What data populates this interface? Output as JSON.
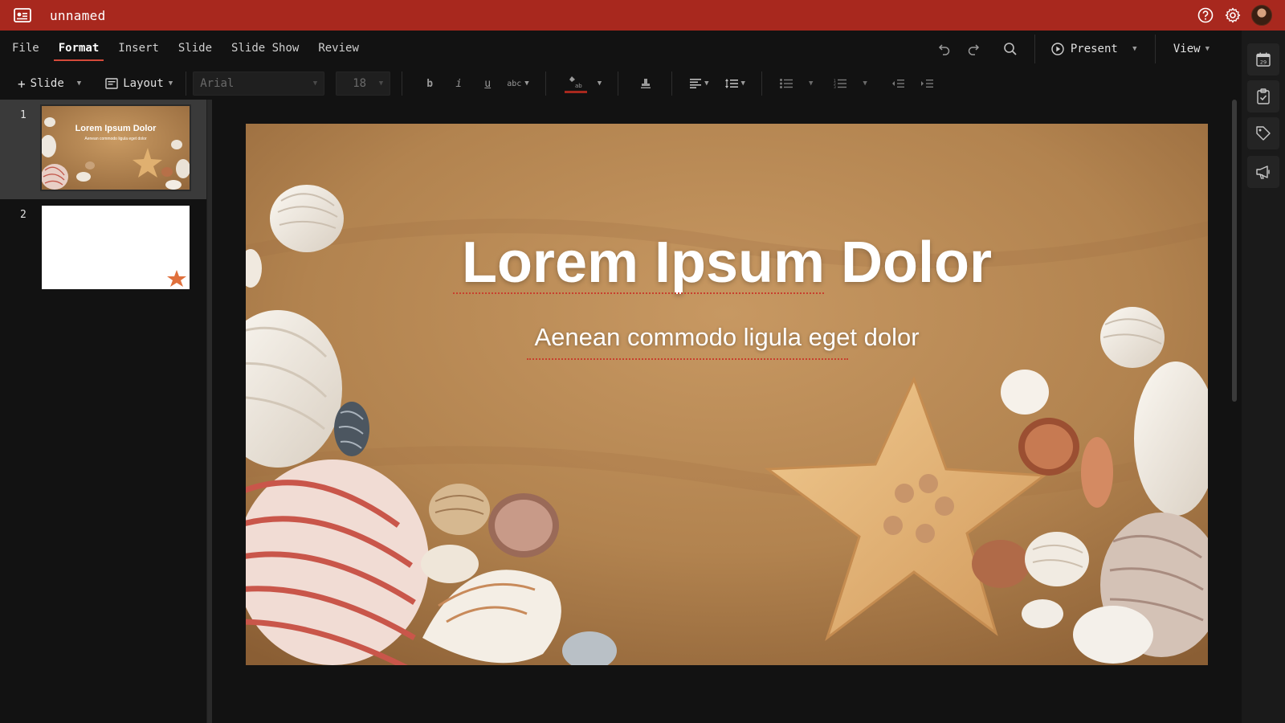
{
  "window": {
    "title": "unnamed"
  },
  "menu": {
    "items": [
      {
        "label": "File"
      },
      {
        "label": "Format"
      },
      {
        "label": "Insert"
      },
      {
        "label": "Slide"
      },
      {
        "label": "Slide Show"
      },
      {
        "label": "Review"
      }
    ],
    "active": "Format",
    "present_label": "Present",
    "view_label": "View"
  },
  "toolbar": {
    "slide_label": "Slide",
    "layout_label": "Layout",
    "font_placeholder": "Arial",
    "font_size_placeholder": "18",
    "font_color": "#a8281e"
  },
  "slides": [
    {
      "number": "1",
      "title": "Lorem Ipsum Dolor",
      "subtitle": "Aenean commodo ligula eget dolor",
      "background": "sand-with-seashells"
    },
    {
      "number": "2",
      "background": "white-with-starfish"
    }
  ],
  "current_slide": {
    "title": "Lorem Ipsum Dolor",
    "subtitle": "Aenean commodo ligula eget dolor"
  },
  "right_rail": {
    "calendar_day": "29",
    "icons": [
      "calendar-icon",
      "clipboard-check-icon",
      "tag-icon",
      "megaphone-icon"
    ]
  },
  "colors": {
    "titlebar": "#a8281e",
    "accent": "#d44a3a",
    "background": "#121212"
  }
}
